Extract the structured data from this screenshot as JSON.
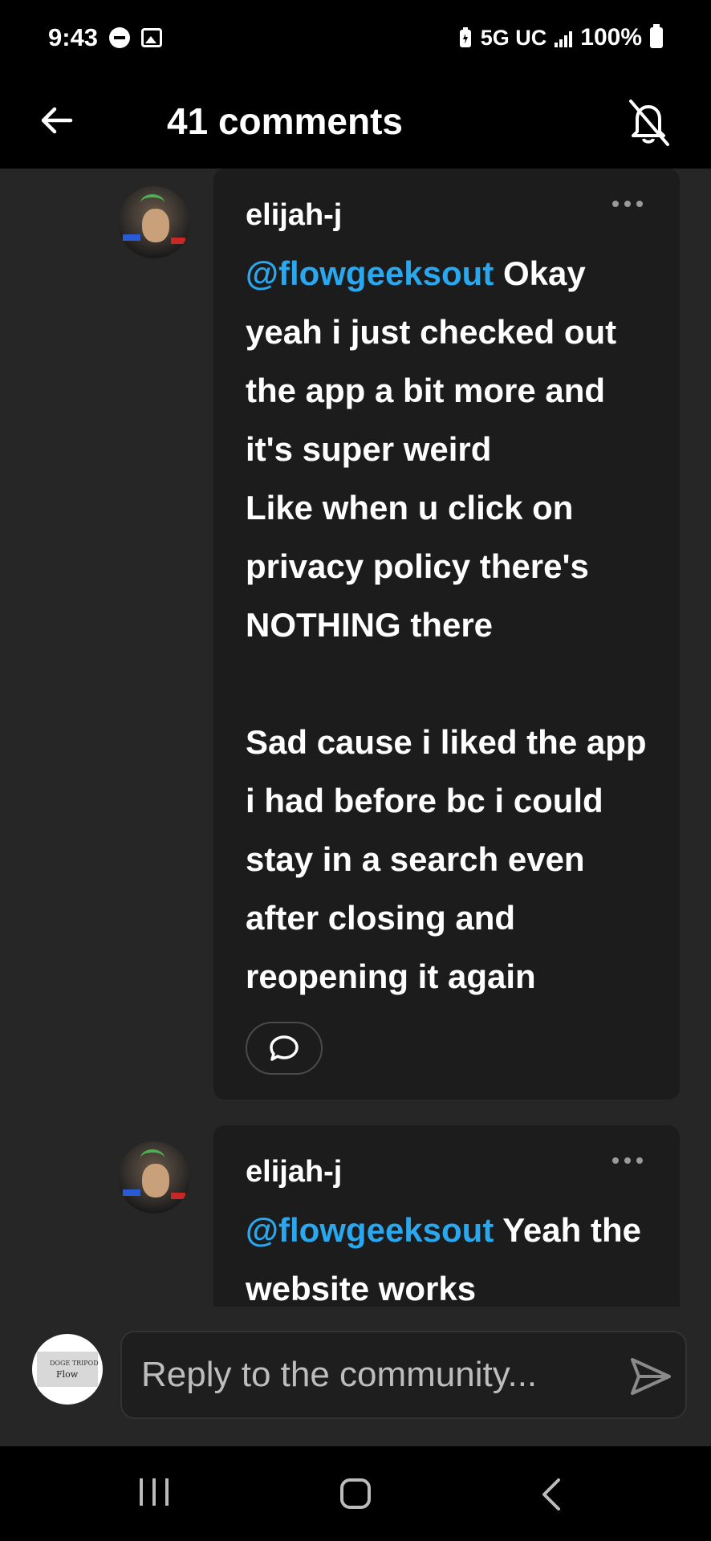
{
  "status_bar": {
    "time": "9:43",
    "network": "5G UC",
    "battery": "100%"
  },
  "header": {
    "title": "41 comments"
  },
  "comments": [
    {
      "author": "elijah-j",
      "mention": "@flowgeeksout",
      "text": " Okay yeah i just checked out the app a bit more and it's super weird\nLike when u click on privacy policy there's NOTHING there\n\nSad cause i liked the app i had before bc i could stay in a search even after closing and reopening it again"
    },
    {
      "author": "elijah-j",
      "mention": "@flowgeeksout",
      "text": " Yeah the website works"
    }
  ],
  "reply_bar": {
    "avatar_small_text": "DOGE TRIPOD",
    "avatar_text": "Flow",
    "placeholder": "Reply to the community..."
  },
  "icons": {
    "back": "arrow-left-icon",
    "bell": "bell-off-icon",
    "more": "more-horizontal-icon",
    "reply": "chat-bubble-icon",
    "send": "send-icon"
  },
  "colors": {
    "mention": "#29a8ef",
    "background": "#262626",
    "card": "#1c1c1c"
  }
}
